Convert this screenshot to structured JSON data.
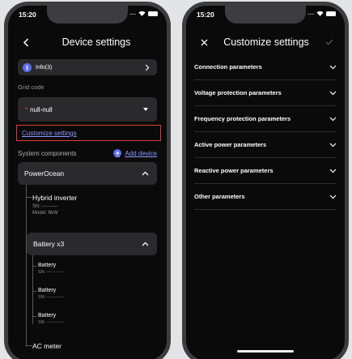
{
  "left_screen": {
    "status_time": "15:20",
    "status_dots": "....",
    "title": "Device settings",
    "info": {
      "label": "Info(3)"
    },
    "grid_code": {
      "label": "Grid code",
      "required_mark": "*",
      "value": "null-null"
    },
    "customize_link": "Customize settings",
    "system_components": {
      "label": "System components",
      "add_icon_glyph": "+",
      "add_device": "Add device"
    },
    "powerocean": {
      "label": "PowerOcean"
    },
    "hybrid_inverter": {
      "title": "Hybrid inverter",
      "sn": "SN: ----------",
      "model": "Model: 6kW"
    },
    "battery_group": {
      "label": "Battery x3"
    },
    "batteries": [
      {
        "title": "Battery",
        "sn": "SN: ------------"
      },
      {
        "title": "Battery",
        "sn": "SN: ------------"
      },
      {
        "title": "Battery",
        "sn": "SN: ------------"
      }
    ],
    "ac_meter": {
      "title": "AC meter"
    }
  },
  "right_screen": {
    "status_time": "15:20",
    "status_dots": "....",
    "title": "Customize settings",
    "params": [
      {
        "label": "Connection parameters"
      },
      {
        "label": "Voltage protection parameters"
      },
      {
        "label": "Frequency protection parameters"
      },
      {
        "label": "Active power parameters"
      },
      {
        "label": "Reactive power parameters"
      },
      {
        "label": "Other parameters"
      }
    ]
  },
  "colors": {
    "background": "#e2e4e7",
    "screen": "#0a0a0a",
    "card": "#2a2a2c",
    "accent": "#5a6ef0",
    "link": "#8a9bff",
    "highlight_border": "#e03a3a",
    "required": "#e34b4b"
  },
  "icons": {
    "back": "chevron-left-icon",
    "info": "info-icon",
    "add": "plus-circle-icon",
    "close": "close-icon",
    "confirm": "check-icon",
    "expand": "chevron-down-icon",
    "collapse": "chevron-up-icon"
  }
}
